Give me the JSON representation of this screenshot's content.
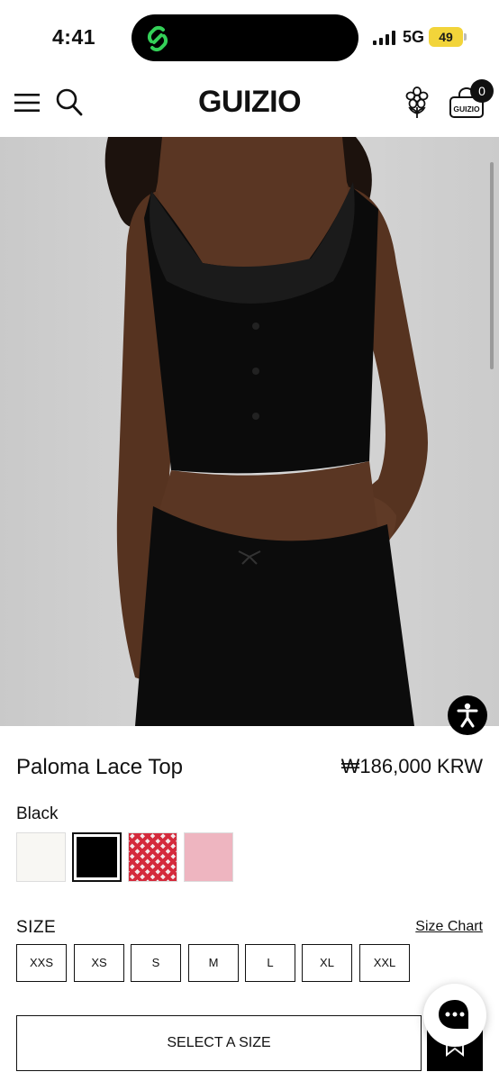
{
  "status_bar": {
    "time": "4:41",
    "network": "5G",
    "battery": "49",
    "battery_color": "#f2d43a",
    "island_icon": "link-app-icon",
    "island_icon_color": "#34d058"
  },
  "header": {
    "logo": "GUIZIO",
    "cart_label": "GUIZIO",
    "cart_count": "0",
    "icons": [
      "menu-icon",
      "search-icon",
      "flower-icon",
      "cart-icon"
    ]
  },
  "product": {
    "image": "model-wearing-black-lace-top",
    "title": "Paloma Lace Top",
    "price": "₩186,000 KRW",
    "selected_color": "Black",
    "swatches": [
      {
        "name": "white",
        "color": "#f8f7f3"
      },
      {
        "name": "black",
        "color": "#000000",
        "selected": true
      },
      {
        "name": "red-gingham",
        "color": "#d42a3c"
      },
      {
        "name": "pink",
        "color": "#eeb5c0"
      }
    ]
  },
  "size": {
    "heading": "SIZE",
    "chart_link": "Size Chart",
    "options": [
      "XXS",
      "XS",
      "S",
      "M",
      "L",
      "XL",
      "XXL"
    ]
  },
  "actions": {
    "select_size": "SELECT A SIZE",
    "wishlist_icon": "bookmark-icon",
    "chat_icon": "chat-icon",
    "accessibility_icon": "accessibility-icon"
  }
}
